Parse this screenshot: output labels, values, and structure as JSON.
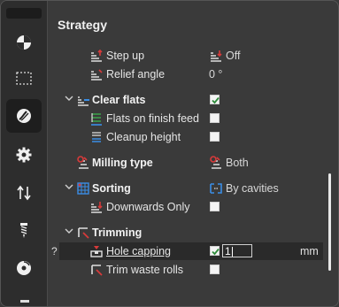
{
  "panel": {
    "title": "Strategy"
  },
  "sidebar": {
    "icons": [
      "contrast-circle-icon",
      "dashed-selection-box-icon",
      "tool-path-icon",
      "gear-icon",
      "sort-arrows-icon",
      "drill-bit-icon",
      "disc-icon"
    ],
    "active_index": 2
  },
  "rows": {
    "step_up": {
      "label": "Step up",
      "value": "Off"
    },
    "relief_angle": {
      "label": "Relief angle",
      "value": "0 °"
    },
    "clear_flats": {
      "label": "Clear flats",
      "checked": true
    },
    "flats_on_finish_feed": {
      "label": "Flats on finish feed",
      "checked": false
    },
    "cleanup_height": {
      "label": "Cleanup height",
      "checked": false
    },
    "milling_type": {
      "label": "Milling type",
      "value": "Both"
    },
    "sorting": {
      "label": "Sorting",
      "value": "By cavities"
    },
    "downwards_only": {
      "label": "Downwards Only",
      "checked": false
    },
    "trimming": {
      "label": "Trimming"
    },
    "hole_capping": {
      "label": "Hole capping",
      "checked": true,
      "value": "1",
      "unit": "mm",
      "help": "?"
    },
    "trim_waste_rolls": {
      "label": "Trim waste rolls",
      "checked": false
    }
  },
  "colors": {
    "accent_blue": "#3a8ee6",
    "accent_red": "#d83a3a",
    "accent_green": "#3aa54a",
    "highlight_row": "#2a2a2a"
  }
}
